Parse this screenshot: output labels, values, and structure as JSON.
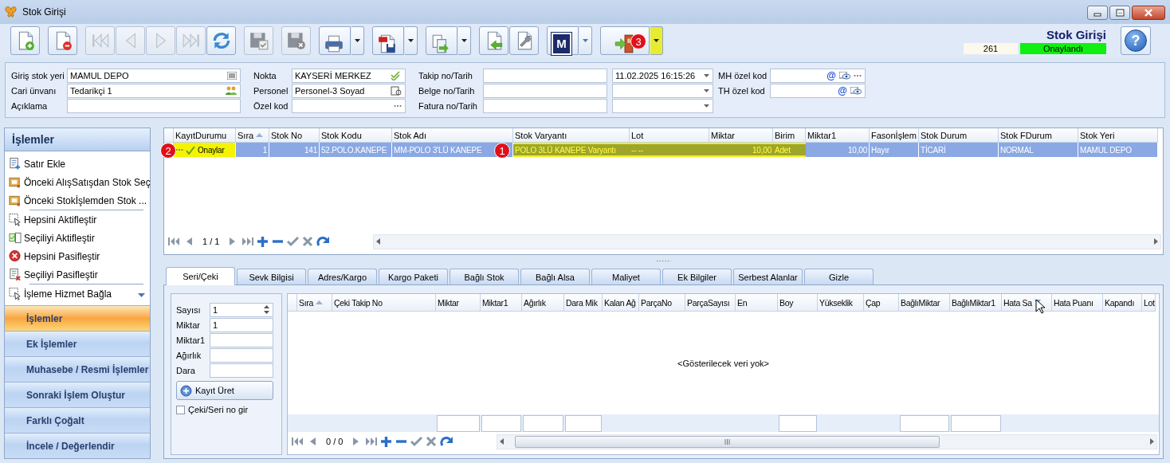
{
  "window": {
    "title": "Stok Girişi"
  },
  "toolbar": {
    "groups": [
      [
        {
          "kind": "button",
          "disabled": false
        }
      ],
      [
        {
          "kind": "button",
          "disabled": false
        }
      ],
      [
        {
          "kind": "button",
          "disabled": true
        },
        {
          "kind": "button",
          "disabled": true
        },
        {
          "kind": "button",
          "disabled": true
        },
        {
          "kind": "button",
          "disabled": true
        },
        {
          "kind": "button",
          "disabled": false
        }
      ],
      [
        {
          "kind": "button",
          "disabled": true
        }
      ],
      [
        {
          "kind": "button",
          "disabled": true
        }
      ],
      [
        {
          "kind": "split",
          "disabled": false
        }
      ],
      [
        {
          "kind": "split",
          "disabled": false
        }
      ],
      [
        {
          "kind": "split",
          "disabled": false
        }
      ],
      [
        {
          "kind": "button",
          "disabled": false
        },
        {
          "kind": "button",
          "disabled": false
        }
      ],
      [
        {
          "kind": "split",
          "disabled": false,
          "label": "M"
        }
      ],
      [
        {
          "kind": "split",
          "disabled": false,
          "highlight": true,
          "badge": "3"
        }
      ]
    ]
  },
  "header": {
    "title": "Stok Girişi",
    "number": "261",
    "status": "Onaylandı",
    "help": "?"
  },
  "form": {
    "columns": [
      [
        {
          "label": "Giriş stok yeri",
          "value": "MAMUL DEPO",
          "kind": "barcode"
        },
        {
          "label": "Cari ünvanı",
          "value": "Tedarikçi 1",
          "kind": "people"
        },
        {
          "label": "Açıklama",
          "kind": "plain"
        }
      ],
      [
        {
          "label": "Nokta",
          "value": "KAYSERİ MERKEZ",
          "kind": "check"
        },
        {
          "label": "Personel",
          "value": "Personel-3 Soyad",
          "kind": "lookup"
        },
        {
          "label": "Özel kod",
          "kind": "ellipsis"
        }
      ],
      [
        {
          "label": "Takip no/Tarih",
          "kind": "dated",
          "date": "11.02.2025 16:15:26"
        },
        {
          "label": "Belge no/Tarih",
          "kind": "dated"
        },
        {
          "label": "Fatura no/Tarih",
          "kind": "dated"
        }
      ],
      [
        {
          "label": "MH özel kod",
          "kind": "code",
          "suffix": "@",
          "more": true
        },
        {
          "label": "TH özel kod",
          "kind": "code",
          "suffix": "@"
        }
      ]
    ]
  },
  "sidebar": {
    "title": "İşlemler",
    "items": [
      {
        "label": "Satır Ekle"
      },
      {
        "label": "Önceki AlışSatışdan Stok Seç"
      },
      {
        "label": "Önceki Stokİşlemden Stok ...",
        "separator_after": true
      },
      {
        "label": "Hepsini Aktifleştir"
      },
      {
        "label": "Seçiliyi Aktifleştir"
      },
      {
        "label": "Hepsini Pasifleştir"
      },
      {
        "label": "Seçiliyi Pasifleştir",
        "separator_after": true
      },
      {
        "label": "İşleme Hizmet Bağla"
      }
    ],
    "groups": [
      {
        "label": "İşlemler",
        "selected": true
      },
      {
        "label": "Ek İşlemler",
        "selected": false
      },
      {
        "label": "Muhasebe / Resmi İşlemler",
        "selected": false
      },
      {
        "label": "Sonraki İşlem Oluştur",
        "selected": false
      },
      {
        "label": "Farklı Çoğalt",
        "selected": false
      },
      {
        "label": "İncele / Değerlendir",
        "selected": false
      }
    ]
  },
  "grid": {
    "columns": [
      {
        "label": "KayıtDurumu"
      },
      {
        "label": "Sıra",
        "sorted": true,
        "numeric": true
      },
      {
        "label": "Stok No",
        "numeric": true
      },
      {
        "label": "Stok Kodu"
      },
      {
        "label": "Stok Adı"
      },
      {
        "label": "Stok Varyantı"
      },
      {
        "label": "Lot"
      },
      {
        "label": "Miktar",
        "numeric": true
      },
      {
        "label": "Birim"
      },
      {
        "label": "Miktar1",
        "numeric": true
      },
      {
        "label": "Fasonİşlem"
      },
      {
        "label": "Stok Durum"
      },
      {
        "label": "Stok FDurum"
      },
      {
        "label": "Stok Yeri"
      }
    ],
    "rows": [
      {
        "selected": true,
        "cells": [
          {
            "text": "Onaylar",
            "highlighted": true,
            "badge": "2"
          },
          {
            "text": "1"
          },
          {
            "text": "141"
          },
          {
            "text": "52.POLO.KANEPE"
          },
          {
            "text": "MM-POLO 3'LÜ KANEPE"
          },
          {
            "text": "POLO 3LÜ KANEPE Varyantı",
            "framed": true,
            "badge": "1"
          },
          {
            "text": "-- --",
            "framed": true
          },
          {
            "text": "10,00",
            "framed": true
          },
          {
            "text": "Adet",
            "framed": true
          },
          {
            "text": "10,00"
          },
          {
            "text": "Hayır"
          },
          {
            "text": "TİCARİ"
          },
          {
            "text": "NORMAL"
          },
          {
            "text": "MAMUL DEPO"
          }
        ]
      }
    ],
    "navigator": "1 / 1"
  },
  "tabs": [
    {
      "label": "Seri/Çeki",
      "selected": true
    },
    {
      "label": "Sevk Bilgisi",
      "selected": false
    },
    {
      "label": "Adres/Kargo",
      "selected": false
    },
    {
      "label": "Kargo Paketi",
      "selected": false
    },
    {
      "label": "Bağlı Stok",
      "selected": false
    },
    {
      "label": "Bağlı Alsa",
      "selected": false
    },
    {
      "label": "Maliyet",
      "selected": false
    },
    {
      "label": "Ek Bilgiler",
      "selected": false
    },
    {
      "label": "Serbest Alanlar",
      "selected": false
    },
    {
      "label": "Gizle",
      "selected": false
    }
  ],
  "serial_form": {
    "fields": [
      {
        "label": "Sayısı",
        "value": "1",
        "kind": "spin"
      },
      {
        "label": "Miktar",
        "value": "1",
        "kind": "text"
      },
      {
        "label": "Miktar1",
        "kind": "text"
      },
      {
        "label": "Ağırlık",
        "kind": "text"
      },
      {
        "label": "Dara",
        "kind": "text"
      }
    ],
    "button": "Kayıt Üret",
    "checkbox": {
      "label": "Çeki/Seri no gir",
      "checked": false
    }
  },
  "detail_grid": {
    "columns": [
      {
        "label": "Sıra",
        "sorted": true
      },
      {
        "label": "Çeki Takip No"
      },
      {
        "label": "Miktar",
        "summary": true
      },
      {
        "label": "Miktar1",
        "summary": true
      },
      {
        "label": "Ağırlık",
        "summary": true
      },
      {
        "label": "Dara Mik",
        "summary": true
      },
      {
        "label": "Kalan Ağ"
      },
      {
        "label": "ParçaNo"
      },
      {
        "label": "ParçaSayısı"
      },
      {
        "label": "En"
      },
      {
        "label": "Boy",
        "summary": true
      },
      {
        "label": "Yükseklik"
      },
      {
        "label": "Çap"
      },
      {
        "label": "BağlıMiktar",
        "summary": true
      },
      {
        "label": "BağlıMiktar1",
        "summary": true
      },
      {
        "label": "Hata Sa",
        "filter": true
      },
      {
        "label": "Hata Puanı"
      },
      {
        "label": "Kapandı"
      },
      {
        "label": "Lot"
      }
    ],
    "empty_text": "<Gösterilecek veri yok>",
    "navigator": "0 / 0"
  }
}
